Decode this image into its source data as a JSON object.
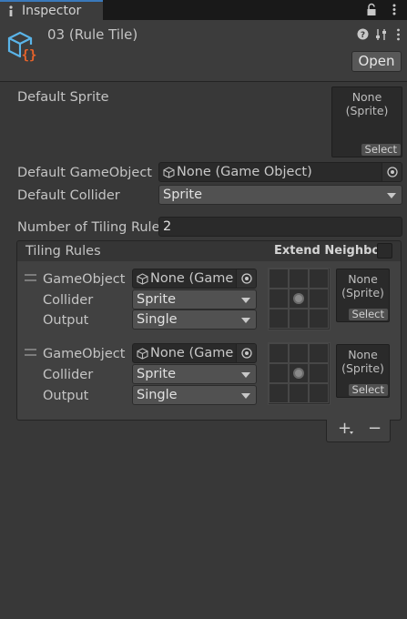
{
  "tab": {
    "title": "Inspector"
  },
  "header": {
    "asset_title": "03 (Rule Tile)",
    "open_label": "Open"
  },
  "fields": {
    "default_sprite_label": "Default Sprite",
    "default_sprite": {
      "none": "None",
      "sprite": "(Sprite)",
      "select": "Select"
    },
    "default_gameobject_label": "Default GameObject",
    "default_gameobject_value": "None (Game Object)",
    "default_collider_label": "Default Collider",
    "default_collider_value": "Sprite",
    "num_rules_label": "Number of Tiling Rule",
    "num_rules_value": "2"
  },
  "tiling_rules": {
    "title": "Tiling Rules",
    "extend_neighbor_label": "Extend Neighbor",
    "extend_neighbor_checked": false,
    "rules": [
      {
        "gameobject_label": "GameObject",
        "gameobject_value": "None (Game",
        "collider_label": "Collider",
        "collider_value": "Sprite",
        "output_label": "Output",
        "output_value": "Single",
        "sprite": {
          "none": "None",
          "sprite": "(Sprite)",
          "select": "Select"
        }
      },
      {
        "gameobject_label": "GameObject",
        "gameobject_value": "None (Game",
        "collider_label": "Collider",
        "collider_value": "Sprite",
        "output_label": "Output",
        "output_value": "Single",
        "sprite": {
          "none": "None",
          "sprite": "(Sprite)",
          "select": "Select"
        }
      }
    ],
    "add_symbol": "+",
    "remove_symbol": "−"
  },
  "colors": {
    "background": "#383838",
    "tab_accent": "#3a79bb",
    "asset_icon_blue": "#5ab4e8",
    "asset_icon_orange": "#e8632a"
  },
  "icons": [
    "inspector-tab-icon",
    "lock-icon",
    "menu-dots-icon",
    "rule-tile-asset-icon",
    "help-icon",
    "preset-icon",
    "more-icon",
    "cube-icon",
    "object-picker-icon",
    "drag-handle-icon",
    "center-dot-icon"
  ]
}
